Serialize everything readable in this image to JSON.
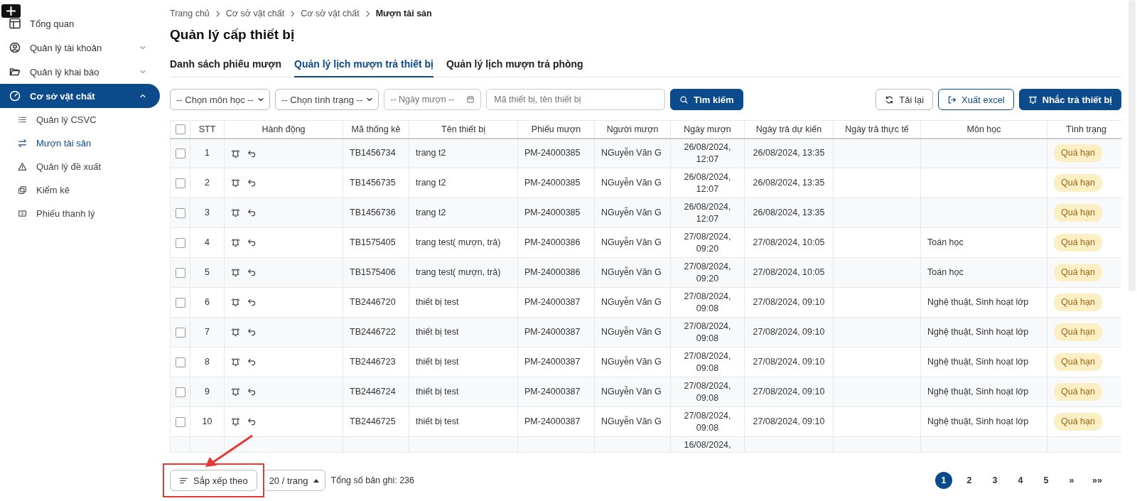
{
  "breadcrumb": [
    "Trang chủ",
    "Cơ sở vật chất",
    "Cơ sở vật chất",
    "Mượn tài sản"
  ],
  "page_title": "Quản lý cấp thiết bị",
  "sidebar": {
    "items": [
      {
        "label": "Tổng quan",
        "selected": false
      },
      {
        "label": "Quản lý tài khoản",
        "selected": false,
        "expanded": false
      },
      {
        "label": "Quản lý khai báo",
        "selected": false,
        "expanded": false
      },
      {
        "label": "Cơ sở vật chất",
        "selected": true,
        "expanded": true,
        "children": [
          {
            "label": "Quản lý CSVC",
            "selected": false
          },
          {
            "label": "Mượn tài sản",
            "selected": true
          },
          {
            "label": "Quản lý đề xuất",
            "selected": false
          },
          {
            "label": "Kiểm kê",
            "selected": false
          },
          {
            "label": "Phiếu thanh lý",
            "selected": false
          }
        ]
      }
    ]
  },
  "tabs": [
    {
      "label": "Danh sách phiếu mượn",
      "selected": false
    },
    {
      "label": "Quản lý lịch mượn trả thiết bị",
      "selected": true
    },
    {
      "label": "Quản lý lịch mượn trả phòng",
      "selected": false
    }
  ],
  "filters": {
    "subject": {
      "placeholder": "-- Chọn môn học --"
    },
    "status": {
      "placeholder": "-- Chọn tình trạng --"
    },
    "date": {
      "placeholder": "-- Ngày mượn --"
    },
    "search": {
      "placeholder": "Mã thiết bị, tên thiết bị"
    },
    "search_button": "Tìm kiếm"
  },
  "actions": [
    {
      "label": "Tải lại",
      "kind": "reload"
    },
    {
      "label": "Xuất excel",
      "kind": "export"
    },
    {
      "label": "Nhắc trả thiết bị",
      "kind": "remind"
    }
  ],
  "table": {
    "all_checked": false,
    "columns": [
      "STT",
      "Hành động",
      "Mã thống kê",
      "Tên thiết bị",
      "Phiếu mượn",
      "Người mượn",
      "Ngày mượn",
      "Ngày trả dự kiến",
      "Ngày trả thực tế",
      "Môn học",
      "Tình trạng"
    ],
    "rows": [
      {
        "checked": false,
        "stt": "1",
        "code": "TB1456734",
        "name": "trang t2",
        "slip": "PM-24000385",
        "borrower": "NGuyễn Văn G",
        "borrow_date": "26/08/2024, 12:07",
        "due_date": "26/08/2024, 13:35",
        "status": "Quá hạn"
      },
      {
        "checked": false,
        "stt": "2",
        "code": "TB1456735",
        "name": "trang t2",
        "slip": "PM-24000385",
        "borrower": "NGuyễn Văn G",
        "borrow_date": "26/08/2024, 12:07",
        "due_date": "26/08/2024, 13:35",
        "status": "Quá hạn"
      },
      {
        "checked": false,
        "stt": "3",
        "code": "TB1456736",
        "name": "trang t2",
        "slip": "PM-24000385",
        "borrower": "NGuyễn Văn G",
        "borrow_date": "26/08/2024, 12:07",
        "due_date": "26/08/2024, 13:35",
        "status": "Quá hạn"
      },
      {
        "checked": false,
        "stt": "4",
        "code": "TB1575405",
        "name": "trang test( mượn, trả)",
        "slip": "PM-24000386",
        "borrower": "NGuyễn Văn G",
        "borrow_date": "27/08/2024, 09:20",
        "due_date": "27/08/2024, 10:05",
        "subject": "Toán học",
        "status": "Quá hạn"
      },
      {
        "checked": false,
        "stt": "5",
        "code": "TB1575406",
        "name": "trang test( mượn, trả)",
        "slip": "PM-24000386",
        "borrower": "NGuyễn Văn G",
        "borrow_date": "27/08/2024, 09:20",
        "due_date": "27/08/2024, 10:05",
        "subject": "Toán học",
        "status": "Quá hạn"
      },
      {
        "checked": false,
        "stt": "6",
        "code": "TB2446720",
        "name": "thiết bị test",
        "slip": "PM-24000387",
        "borrower": "NGuyễn Văn G",
        "borrow_date": "27/08/2024, 09:08",
        "due_date": "27/08/2024, 09:10",
        "subject": "Nghệ thuật, Sinh hoạt lớp",
        "status": "Quá hạn"
      },
      {
        "checked": false,
        "stt": "7",
        "code": "TB2446722",
        "name": "thiết bị test",
        "slip": "PM-24000387",
        "borrower": "NGuyễn Văn G",
        "borrow_date": "27/08/2024, 09:08",
        "due_date": "27/08/2024, 09:10",
        "subject": "Nghệ thuật, Sinh hoạt lớp",
        "status": "Quá hạn"
      },
      {
        "checked": false,
        "stt": "8",
        "code": "TB2446723",
        "name": "thiết bị test",
        "slip": "PM-24000387",
        "borrower": "NGuyễn Văn G",
        "borrow_date": "27/08/2024, 09:08",
        "due_date": "27/08/2024, 09:10",
        "subject": "Nghệ thuật, Sinh hoạt lớp",
        "status": "Quá hạn"
      },
      {
        "checked": false,
        "stt": "9",
        "code": "TB2446724",
        "name": "thiết bị test",
        "slip": "PM-24000387",
        "borrower": "NGuyễn Văn G",
        "borrow_date": "27/08/2024, 09:08",
        "due_date": "27/08/2024, 09:10",
        "subject": "Nghệ thuật, Sinh hoạt lớp",
        "status": "Quá hạn"
      },
      {
        "checked": false,
        "stt": "10",
        "code": "TB2446725",
        "name": "thiết bị test",
        "slip": "PM-24000387",
        "borrower": "NGuyễn Văn G",
        "borrow_date": "27/08/2024, 09:08",
        "due_date": "27/08/2024, 09:10",
        "subject": "Nghệ thuật, Sinh hoạt lớp",
        "status": "Quá hạn"
      }
    ],
    "partial_row": {
      "borrow_date": "16/08/2024,"
    }
  },
  "footer": {
    "sort_button": "Sắp xếp theo",
    "page_size": "20 / trang",
    "total": "Tổng số bản ghi: 236",
    "pages": [
      {
        "label": "1",
        "selected": true
      },
      {
        "label": "2",
        "selected": false
      },
      {
        "label": "3",
        "selected": false
      },
      {
        "label": "4",
        "selected": false
      },
      {
        "label": "5",
        "selected": false
      }
    ],
    "next": "»",
    "last": "»»"
  },
  "annotations": [
    {
      "kind": "highlight-arrow"
    }
  ]
}
